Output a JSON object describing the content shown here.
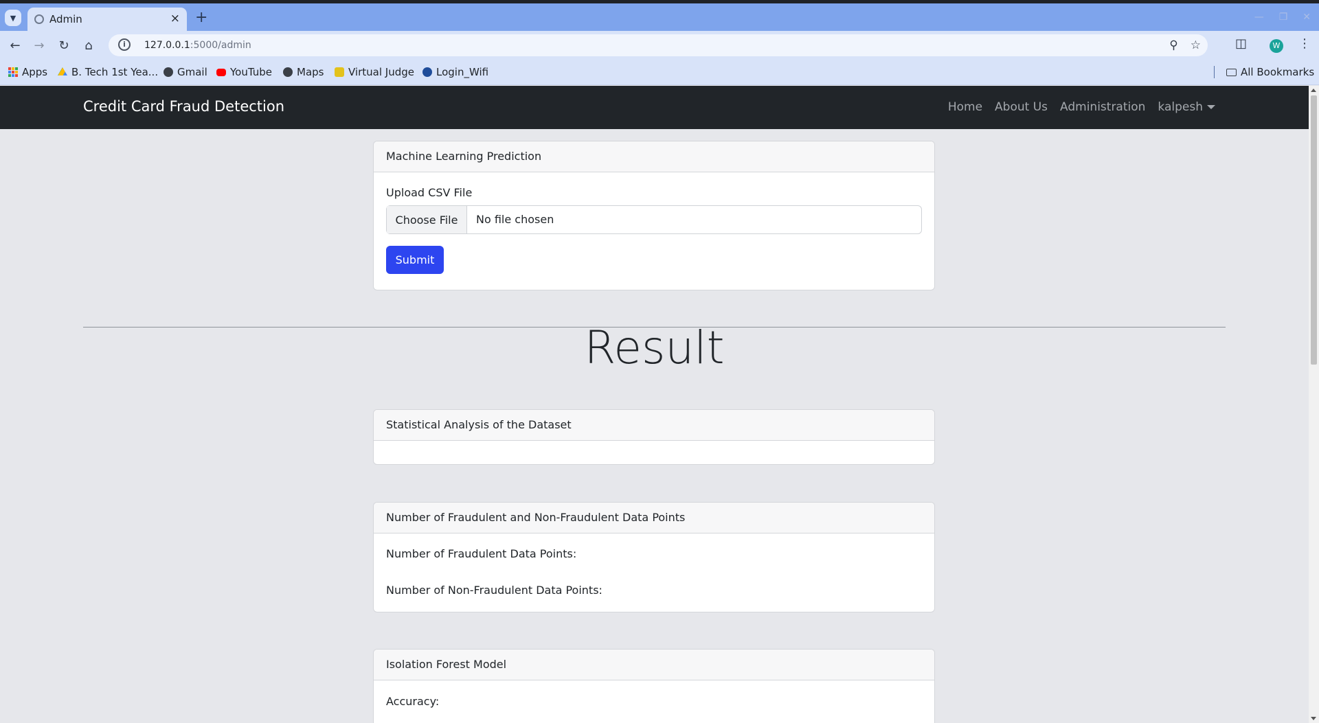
{
  "browser": {
    "tab_title": "Admin",
    "url_host": "127.0.0.1",
    "url_rest": ":5000/admin",
    "profile_initial": "W",
    "bookmarks": [
      {
        "label": "Apps"
      },
      {
        "label": "B. Tech 1st Yea..."
      },
      {
        "label": "Gmail"
      },
      {
        "label": "YouTube"
      },
      {
        "label": "Maps"
      },
      {
        "label": "Virtual Judge"
      },
      {
        "label": "Login_Wifi"
      }
    ],
    "all_bookmarks": "All Bookmarks"
  },
  "navbar": {
    "brand": "Credit Card Fraud Detection",
    "links": [
      "Home",
      "About Us",
      "Administration"
    ],
    "user": "kalpesh"
  },
  "upload_card": {
    "header": "Machine Learning Prediction",
    "label": "Upload CSV File",
    "choose_file": "Choose File",
    "no_file": "No file chosen",
    "submit": "Submit"
  },
  "result": {
    "title": "Result"
  },
  "stats_card": {
    "header": "Statistical Analysis of the Dataset"
  },
  "counts_card": {
    "header": "Number of Fraudulent and Non-Fraudulent Data Points",
    "fraud_label": "Number of Fraudulent Data Points:",
    "nonfraud_label": "Number of Non-Fraudulent Data Points:"
  },
  "iforest_card": {
    "header": "Isolation Forest Model",
    "accuracy_label": "Accuracy:"
  }
}
